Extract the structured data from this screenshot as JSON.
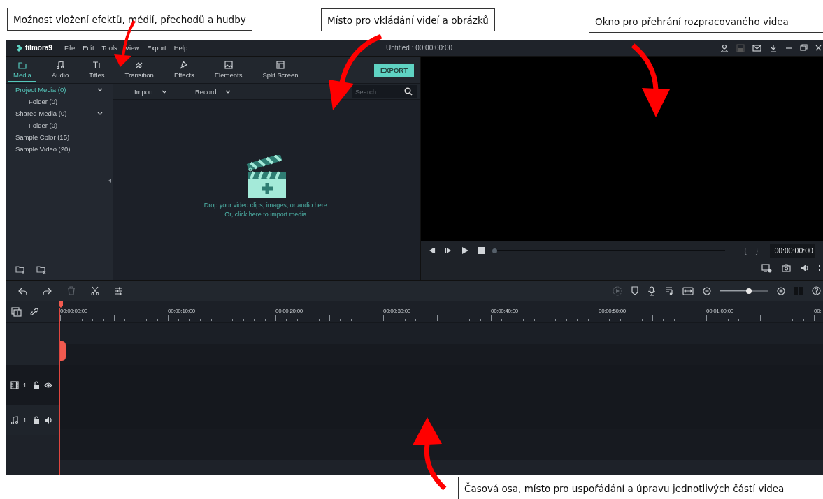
{
  "annotations": [
    {
      "text": "Možnost vložení efektů, médií, přechodů a hudby"
    },
    {
      "text": "Místo pro vkládání videí a obrázků"
    },
    {
      "text": "Okno pro přehrání rozpracovaného videa"
    },
    {
      "text": "Časová osa, místo pro uspořádání a úpravu jednotlivých částí videa"
    }
  ],
  "title_bar": {
    "logo": "filmora9",
    "menu": [
      "File",
      "Edit",
      "Tools",
      "View",
      "Export",
      "Help"
    ],
    "title": "Untitled : 00:00:00:00"
  },
  "tabs": [
    {
      "label": "Media",
      "selected": true
    },
    {
      "label": "Audio",
      "selected": false
    },
    {
      "label": "Titles",
      "selected": false
    },
    {
      "label": "Transition",
      "selected": false
    },
    {
      "label": "Effects",
      "selected": false
    },
    {
      "label": "Elements",
      "selected": false
    },
    {
      "label": "Split Screen",
      "selected": false
    }
  ],
  "export_button": "EXPORT",
  "sidebar": {
    "items": [
      {
        "label": "Project Media (0)",
        "selected": true,
        "expanded": true,
        "children": [
          {
            "label": "Folder (0)",
            "selected": false
          }
        ]
      },
      {
        "label": "Shared Media (0)",
        "selected": false,
        "expanded": true,
        "children": [
          {
            "label": "Folder (0)",
            "selected": false
          }
        ]
      },
      {
        "label": "Sample Color (15)",
        "selected": false
      },
      {
        "label": "Sample Video (20)",
        "selected": false
      }
    ]
  },
  "media_toolbar": {
    "import": "Import",
    "record": "Record",
    "search": {
      "placeholder": "Search"
    }
  },
  "drop_hint": [
    "Drop your video clips, images, or audio here.",
    "Or, click here to import media."
  ],
  "player": {
    "progress": {
      "level": 0
    },
    "mark_in": "{",
    "mark_out": "}",
    "timecode": "00:00:00:00"
  },
  "timeline": {
    "zoom": {
      "level": 0.6
    },
    "ruler": [
      "00:00:00:00",
      "00:00:10:00",
      "00:00:20:00",
      "00:00:30:00",
      "00:00:40:00",
      "00:00:50:00",
      "00:01:00:00",
      "00:"
    ],
    "tracks": [
      {
        "kind": "video",
        "number": "1"
      },
      {
        "kind": "audio",
        "number": "1"
      }
    ]
  }
}
